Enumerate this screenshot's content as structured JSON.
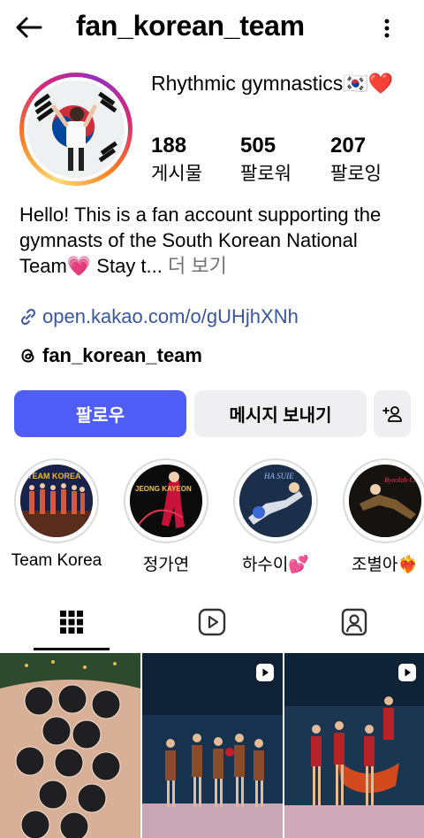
{
  "header": {
    "username": "fan_korean_team",
    "back_icon": "arrow-left-icon",
    "menu_icon": "more-vertical-icon"
  },
  "profile": {
    "display_name": "Rhythmic gymnastics🇰🇷❤️",
    "stats": [
      {
        "value": "188",
        "label": "게시물"
      },
      {
        "value": "505",
        "label": "팔로워"
      },
      {
        "value": "207",
        "label": "팔로잉"
      }
    ],
    "bio": "Hello! This is a fan account supporting the gymnasts of the South Korean National Team💗 Stay t...",
    "bio_more": " 더 보기",
    "link": "open.kakao.com/o/gUHjhXNh",
    "threads_handle": "fan_korean_team"
  },
  "actions": {
    "follow_label": "팔로우",
    "message_label": "메시지 보내기",
    "add_icon": "person-add-icon"
  },
  "highlights": [
    {
      "label": "Team Korea",
      "image_text": "TEAM KOREA"
    },
    {
      "label": "정가연",
      "image_text": "JEONG KAYEON"
    },
    {
      "label": "하수이💕",
      "image_text": "HA SUIE"
    },
    {
      "label": "조별아❤️‍🔥",
      "image_text": "Byeolah Cho"
    }
  ],
  "tabs": [
    {
      "icon": "grid-icon",
      "active": true
    },
    {
      "icon": "reels-icon",
      "active": false
    },
    {
      "icon": "tagged-icon",
      "active": false
    }
  ],
  "colors": {
    "accent": "#4f5ef6",
    "link": "#3757a3",
    "secondary_button": "#efeff1"
  }
}
